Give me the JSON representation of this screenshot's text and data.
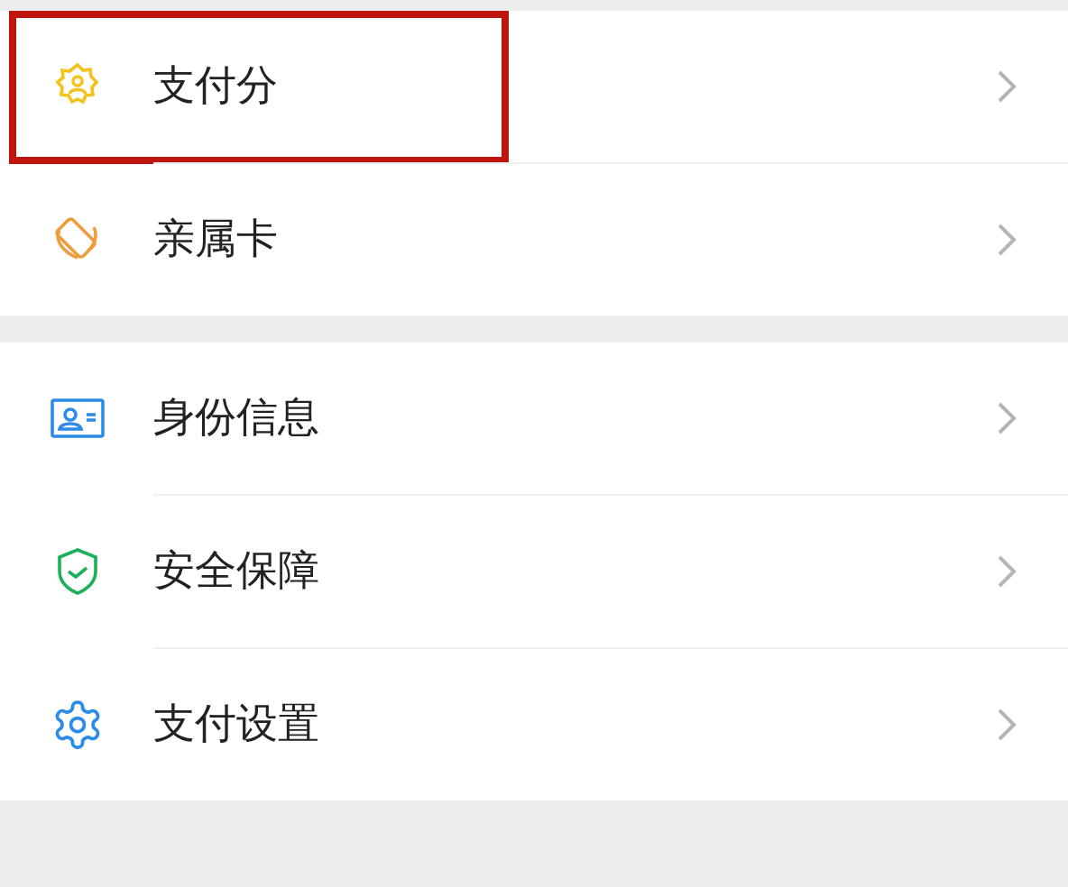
{
  "groups": [
    {
      "items": [
        {
          "label": "支付分",
          "kind": "score",
          "highlighted": true
        },
        {
          "label": "亲属卡",
          "kind": "card",
          "highlighted": false
        }
      ]
    },
    {
      "items": [
        {
          "label": "身份信息",
          "kind": "id",
          "highlighted": false
        },
        {
          "label": "安全保障",
          "kind": "shield",
          "highlighted": false
        },
        {
          "label": "支付设置",
          "kind": "gear",
          "highlighted": false
        }
      ]
    }
  ]
}
